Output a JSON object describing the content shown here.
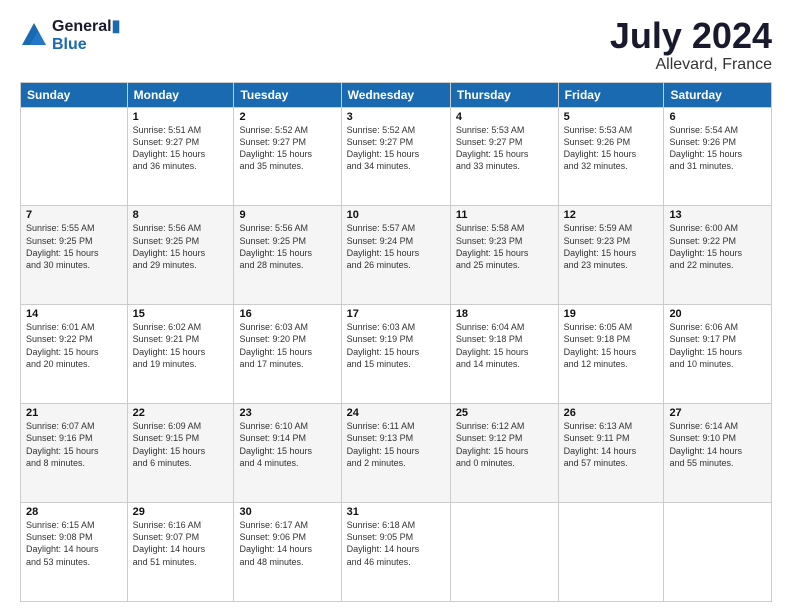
{
  "logo": {
    "line1": "General",
    "line2": "Blue"
  },
  "title": "July 2024",
  "location": "Allevard, France",
  "days_of_week": [
    "Sunday",
    "Monday",
    "Tuesday",
    "Wednesday",
    "Thursday",
    "Friday",
    "Saturday"
  ],
  "weeks": [
    [
      {
        "day": "",
        "info": ""
      },
      {
        "day": "1",
        "info": "Sunrise: 5:51 AM\nSunset: 9:27 PM\nDaylight: 15 hours\nand 36 minutes."
      },
      {
        "day": "2",
        "info": "Sunrise: 5:52 AM\nSunset: 9:27 PM\nDaylight: 15 hours\nand 35 minutes."
      },
      {
        "day": "3",
        "info": "Sunrise: 5:52 AM\nSunset: 9:27 PM\nDaylight: 15 hours\nand 34 minutes."
      },
      {
        "day": "4",
        "info": "Sunrise: 5:53 AM\nSunset: 9:27 PM\nDaylight: 15 hours\nand 33 minutes."
      },
      {
        "day": "5",
        "info": "Sunrise: 5:53 AM\nSunset: 9:26 PM\nDaylight: 15 hours\nand 32 minutes."
      },
      {
        "day": "6",
        "info": "Sunrise: 5:54 AM\nSunset: 9:26 PM\nDaylight: 15 hours\nand 31 minutes."
      }
    ],
    [
      {
        "day": "7",
        "info": "Sunrise: 5:55 AM\nSunset: 9:25 PM\nDaylight: 15 hours\nand 30 minutes."
      },
      {
        "day": "8",
        "info": "Sunrise: 5:56 AM\nSunset: 9:25 PM\nDaylight: 15 hours\nand 29 minutes."
      },
      {
        "day": "9",
        "info": "Sunrise: 5:56 AM\nSunset: 9:25 PM\nDaylight: 15 hours\nand 28 minutes."
      },
      {
        "day": "10",
        "info": "Sunrise: 5:57 AM\nSunset: 9:24 PM\nDaylight: 15 hours\nand 26 minutes."
      },
      {
        "day": "11",
        "info": "Sunrise: 5:58 AM\nSunset: 9:23 PM\nDaylight: 15 hours\nand 25 minutes."
      },
      {
        "day": "12",
        "info": "Sunrise: 5:59 AM\nSunset: 9:23 PM\nDaylight: 15 hours\nand 23 minutes."
      },
      {
        "day": "13",
        "info": "Sunrise: 6:00 AM\nSunset: 9:22 PM\nDaylight: 15 hours\nand 22 minutes."
      }
    ],
    [
      {
        "day": "14",
        "info": "Sunrise: 6:01 AM\nSunset: 9:22 PM\nDaylight: 15 hours\nand 20 minutes."
      },
      {
        "day": "15",
        "info": "Sunrise: 6:02 AM\nSunset: 9:21 PM\nDaylight: 15 hours\nand 19 minutes."
      },
      {
        "day": "16",
        "info": "Sunrise: 6:03 AM\nSunset: 9:20 PM\nDaylight: 15 hours\nand 17 minutes."
      },
      {
        "day": "17",
        "info": "Sunrise: 6:03 AM\nSunset: 9:19 PM\nDaylight: 15 hours\nand 15 minutes."
      },
      {
        "day": "18",
        "info": "Sunrise: 6:04 AM\nSunset: 9:18 PM\nDaylight: 15 hours\nand 14 minutes."
      },
      {
        "day": "19",
        "info": "Sunrise: 6:05 AM\nSunset: 9:18 PM\nDaylight: 15 hours\nand 12 minutes."
      },
      {
        "day": "20",
        "info": "Sunrise: 6:06 AM\nSunset: 9:17 PM\nDaylight: 15 hours\nand 10 minutes."
      }
    ],
    [
      {
        "day": "21",
        "info": "Sunrise: 6:07 AM\nSunset: 9:16 PM\nDaylight: 15 hours\nand 8 minutes."
      },
      {
        "day": "22",
        "info": "Sunrise: 6:09 AM\nSunset: 9:15 PM\nDaylight: 15 hours\nand 6 minutes."
      },
      {
        "day": "23",
        "info": "Sunrise: 6:10 AM\nSunset: 9:14 PM\nDaylight: 15 hours\nand 4 minutes."
      },
      {
        "day": "24",
        "info": "Sunrise: 6:11 AM\nSunset: 9:13 PM\nDaylight: 15 hours\nand 2 minutes."
      },
      {
        "day": "25",
        "info": "Sunrise: 6:12 AM\nSunset: 9:12 PM\nDaylight: 15 hours\nand 0 minutes."
      },
      {
        "day": "26",
        "info": "Sunrise: 6:13 AM\nSunset: 9:11 PM\nDaylight: 14 hours\nand 57 minutes."
      },
      {
        "day": "27",
        "info": "Sunrise: 6:14 AM\nSunset: 9:10 PM\nDaylight: 14 hours\nand 55 minutes."
      }
    ],
    [
      {
        "day": "28",
        "info": "Sunrise: 6:15 AM\nSunset: 9:08 PM\nDaylight: 14 hours\nand 53 minutes."
      },
      {
        "day": "29",
        "info": "Sunrise: 6:16 AM\nSunset: 9:07 PM\nDaylight: 14 hours\nand 51 minutes."
      },
      {
        "day": "30",
        "info": "Sunrise: 6:17 AM\nSunset: 9:06 PM\nDaylight: 14 hours\nand 48 minutes."
      },
      {
        "day": "31",
        "info": "Sunrise: 6:18 AM\nSunset: 9:05 PM\nDaylight: 14 hours\nand 46 minutes."
      },
      {
        "day": "",
        "info": ""
      },
      {
        "day": "",
        "info": ""
      },
      {
        "day": "",
        "info": ""
      }
    ]
  ]
}
